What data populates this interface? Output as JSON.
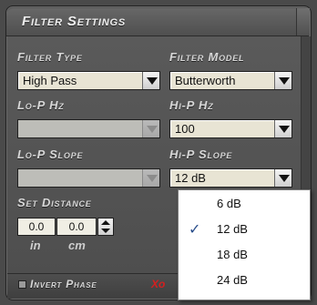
{
  "panel": {
    "title": "Filter Settings"
  },
  "filter_type": {
    "label": "Filter Type",
    "value": "High Pass"
  },
  "filter_model": {
    "label": "Filter Model",
    "value": "Butterworth"
  },
  "lop_hz": {
    "label": "Lo-P  Hz",
    "value": ""
  },
  "hip_hz": {
    "label": "Hi-P  Hz",
    "value": "100"
  },
  "lop_slope": {
    "label": "Lo-P Slope",
    "value": ""
  },
  "hip_slope": {
    "label": "Hi-P Slope",
    "value": "12 dB"
  },
  "set_distance": {
    "label": "Set Distance",
    "in_value": "0.0",
    "cm_value": "0.0",
    "in_unit": "in",
    "cm_unit": "cm"
  },
  "invert_phase": {
    "label": "Invert Phase",
    "side_text": "Xo"
  },
  "slope_menu": {
    "options": [
      {
        "label": "6 dB",
        "checked": false
      },
      {
        "label": "12 dB",
        "checked": true
      },
      {
        "label": "18 dB",
        "checked": false
      },
      {
        "label": "24 dB",
        "checked": false
      }
    ],
    "check_glyph": "✓"
  },
  "colors": {
    "panel_bg": "#4a4a4a",
    "label_text": "#d8d8d8",
    "combo_bg": "#e8e4d4",
    "accent_red": "#d42020",
    "check_blue": "#2b4f8c"
  }
}
